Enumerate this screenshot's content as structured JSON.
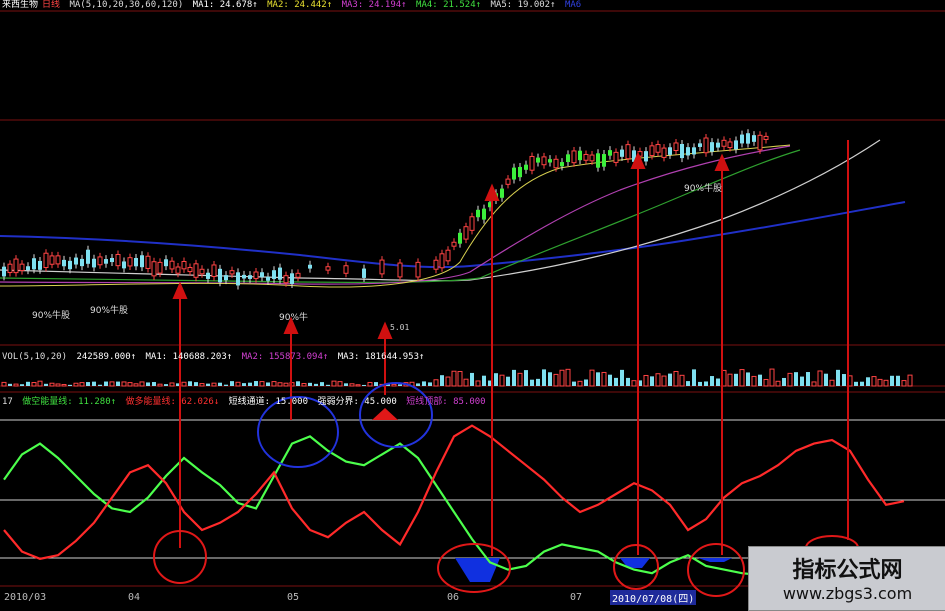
{
  "header": {
    "stock": "来西生物",
    "period": "日线",
    "ma_params": "MA(5,10,20,30,60,120)",
    "ma1": "MA1: 24.678↑",
    "ma2": "MA2: 24.442↑",
    "ma3": "MA3: 24.194↑",
    "ma4": "MA4: 21.524↑",
    "ma5": "MA5: 19.002↑",
    "ma6": "MA6"
  },
  "volume_bar": {
    "params": "VOL(5,10,20)",
    "value": "242589.000↑",
    "ma1": "MA1: 140688.203↑",
    "ma2": "MA2: 155873.094↑",
    "ma3": "MA3: 181644.953↑"
  },
  "indicator_bar": {
    "num": "17",
    "bear": "做空能量线: 11.280↑",
    "bull": "做多能量线: 62.026↓",
    "channel": "短线通道: 15.000",
    "strong": "强弱分界: 45.000",
    "top": "短线顶部: 85.000"
  },
  "annotations": {
    "bull_labels": [
      "90%牛股",
      "90%牛股",
      "90%牛",
      "90%牛股"
    ],
    "cursor_value": "5.01"
  },
  "x_axis": [
    "2010/03",
    "04",
    "05",
    "06",
    "07"
  ],
  "x_axis_highlight": "2010/07/08(四)",
  "watermark": {
    "title": "指标公式网",
    "url": "www.zbgs3.com"
  },
  "colors": {
    "bg": "#000000",
    "bull_line": "#ff2a2a",
    "bear_line": "#4cff4c",
    "up_candle": "#ff4444",
    "down_candle": "#3cf03c",
    "vol_bar": "#7fe0f0",
    "arrow": "#d01010",
    "circle_red": "#e01818",
    "circle_blue": "#2233dd"
  },
  "chart_data": [
    {
      "type": "line",
      "title": "做空/做多能量线",
      "reference_lines": [
        15,
        45,
        85
      ],
      "series": [
        {
          "name": "做空能量线",
          "values": [
            58,
            72,
            78,
            70,
            60,
            50,
            42,
            40,
            48,
            60,
            70,
            62,
            55,
            45,
            42,
            60,
            78,
            82,
            74,
            68,
            66,
            72,
            78,
            70,
            55,
            40,
            25,
            12,
            8,
            10,
            18,
            22,
            20,
            18,
            12,
            8,
            6,
            12,
            16,
            10,
            8,
            6,
            5,
            8,
            12,
            14,
            8,
            6,
            10,
            12,
            4
          ]
        },
        {
          "name": "做多能量线",
          "values": [
            30,
            18,
            14,
            16,
            24,
            34,
            48,
            62,
            66,
            56,
            40,
            30,
            34,
            40,
            50,
            62,
            42,
            30,
            26,
            34,
            40,
            30,
            22,
            40,
            62,
            82,
            88,
            82,
            74,
            66,
            58,
            48,
            40,
            44,
            50,
            56,
            52,
            44,
            30,
            36,
            48,
            56,
            60,
            66,
            74,
            78,
            80,
            74,
            58,
            44,
            46
          ]
        }
      ]
    }
  ]
}
